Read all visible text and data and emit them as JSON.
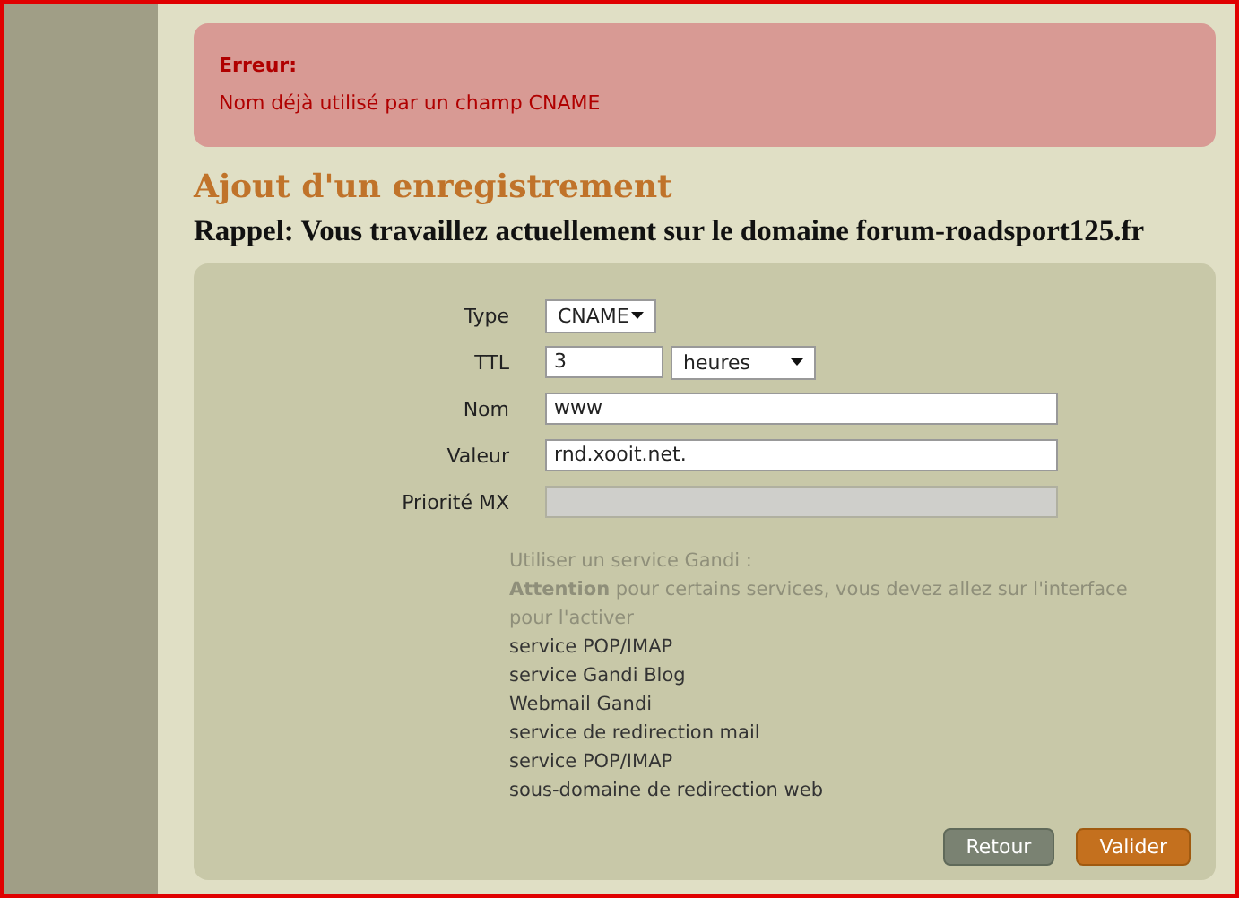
{
  "error": {
    "title": "Erreur:",
    "message": "Nom déjà utilisé par un champ CNAME"
  },
  "heading": "Ajout d'un enregistrement",
  "reminder": "Rappel: Vous travaillez actuellement sur le domaine forum-roadsport125.fr",
  "form": {
    "fields": [
      {
        "label": "Type",
        "kind": "select",
        "value": "CNAME"
      },
      {
        "label": "TTL",
        "kind": "ttl",
        "value": "3",
        "unit": "heures"
      },
      {
        "label": "Nom",
        "kind": "text",
        "value": "www"
      },
      {
        "label": "Valeur",
        "kind": "text",
        "value": "rnd.xooit.net."
      },
      {
        "label": "Priorité MX",
        "kind": "text",
        "disabled": true
      }
    ]
  },
  "gandi": {
    "intro": "Utiliser un service Gandi :",
    "warning": "**Attention** pour certains services, vous devez allez sur l'interface pour l'activer",
    "services": [
      "service POP/IMAP",
      "service Gandi Blog",
      "Webmail Gandi",
      "service de redirection mail",
      "service POP/IMAP",
      "sous-domaine de redirection web"
    ]
  },
  "buttons": [
    {
      "label": "Retour",
      "kind": "secondary"
    },
    {
      "label": "Valider",
      "kind": "primary"
    }
  ]
}
